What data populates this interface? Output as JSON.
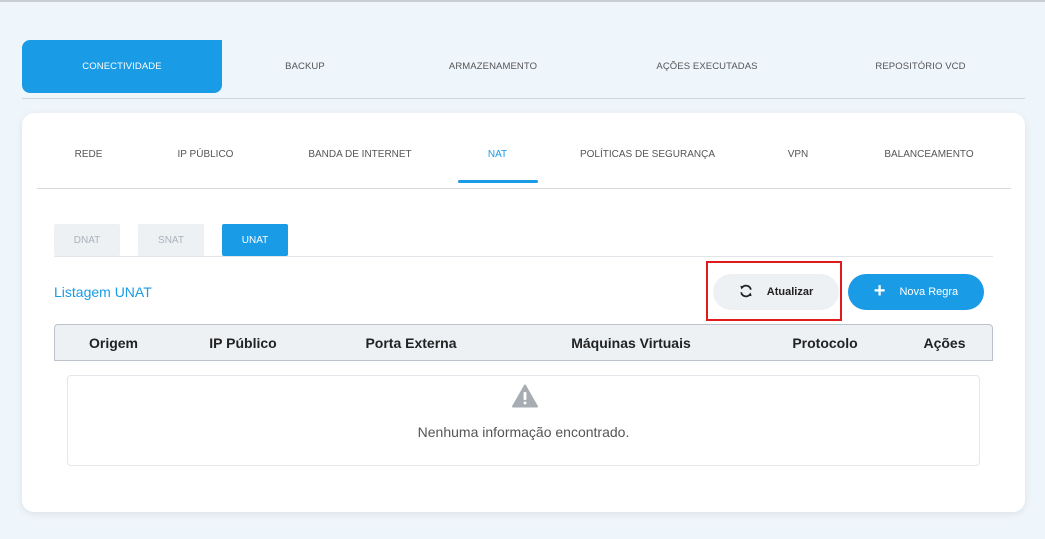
{
  "main_tabs": [
    {
      "label": "CONECTIVIDADE",
      "active": true
    },
    {
      "label": "BACKUP",
      "active": false
    },
    {
      "label": "ARMAZENAMENTO",
      "active": false
    },
    {
      "label": "AÇÕES EXECUTADAS",
      "active": false
    },
    {
      "label": "REPOSITÓRIO VCD",
      "active": false
    }
  ],
  "sub_tabs": [
    {
      "label": "REDE",
      "active": false
    },
    {
      "label": "IP PÚBLICO",
      "active": false
    },
    {
      "label": "BANDA DE INTERNET",
      "active": false
    },
    {
      "label": "NAT",
      "active": true
    },
    {
      "label": "POLÍTICAS DE SEGURANÇA",
      "active": false
    },
    {
      "label": "VPN",
      "active": false
    },
    {
      "label": "BALANCEAMENTO",
      "active": false
    }
  ],
  "nat_tabs": [
    {
      "label": "DNAT",
      "active": false
    },
    {
      "label": "SNAT",
      "active": false
    },
    {
      "label": "UNAT",
      "active": true
    }
  ],
  "listing_title": "Listagem UNAT",
  "buttons": {
    "refresh_label": "Atualizar",
    "new_rule_label": "Nova Regra"
  },
  "table": {
    "columns": [
      "Origem",
      "IP Público",
      "Porta Externa",
      "Máquinas Virtuais",
      "Protocolo",
      "Ações"
    ],
    "empty_message": "Nenhuma informação encontrado."
  },
  "icons": {
    "refresh": "refresh-icon",
    "plus": "plus-icon",
    "warning": "warning-icon"
  },
  "colors": {
    "accent": "#1a9be6",
    "highlight": "#e01b1b"
  }
}
